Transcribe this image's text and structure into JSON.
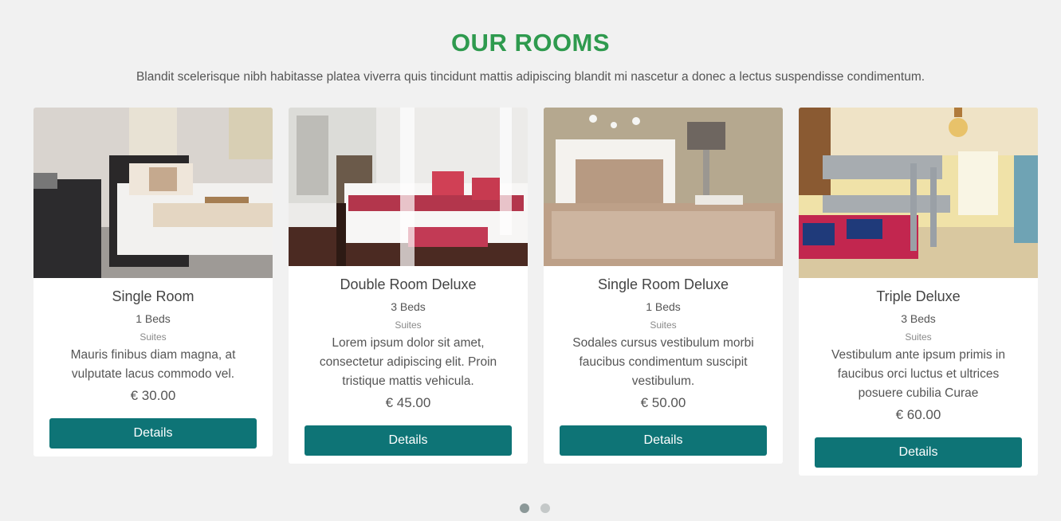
{
  "section": {
    "title": "OUR ROOMS",
    "subtitle": "Blandit scelerisque nibh habitasse platea viverra quis tincidunt mattis adipiscing blandit mi nascetur a donec a lectus suspendisse condimentum."
  },
  "rooms": [
    {
      "name": "Single Room",
      "beds": "1 Beds",
      "type": "Suites",
      "description": "Mauris finibus diam magna, at vulputate lacus commodo vel.",
      "price": "€ 30.00",
      "button_label": "Details"
    },
    {
      "name": "Double Room Deluxe",
      "beds": "3 Beds",
      "type": "Suites",
      "description": "Lorem ipsum dolor sit amet, consectetur adipiscing elit. Proin tristique mattis vehicula.",
      "price": "€ 45.00",
      "button_label": "Details"
    },
    {
      "name": "Single Room Deluxe",
      "beds": "1 Beds",
      "type": "Suites",
      "description": "Sodales cursus vestibulum morbi faucibus condimentum suscipit vestibulum.",
      "price": "€ 50.00",
      "button_label": "Details"
    },
    {
      "name": "Triple Deluxe",
      "beds": "3 Beds",
      "type": "Suites",
      "description": "Vestibulum ante ipsum primis in faucibus orci luctus et ultrices posuere cubilia Curae",
      "price": "€ 60.00",
      "button_label": "Details"
    }
  ],
  "carousel": {
    "pages": 2,
    "active_page": 1
  },
  "colors": {
    "title": "#2e9a4e",
    "button": "#0e7476",
    "background": "#f1f1f1"
  }
}
